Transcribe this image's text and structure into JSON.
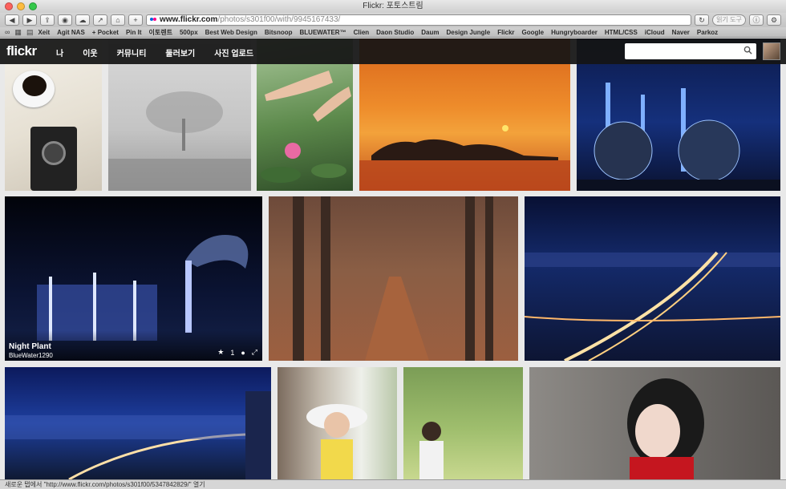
{
  "window": {
    "title": "Flickr: 포토스트림"
  },
  "toolbar": {
    "url_domain": "www.flickr.com",
    "url_path": "/photos/s301f00/with/9945167433/",
    "search_placeholder": "읽기 도구"
  },
  "bookmarks": [
    "Xeit",
    "Agit NAS",
    "+ Pocket",
    "Pin It",
    "이토렌트",
    "500px",
    "Best Web Design",
    "Bitsnoop",
    "BLUEWATER™",
    "Clien",
    "Daon Studio",
    "Daum",
    "Design Jungle",
    "Flickr",
    "Google",
    "Hungryboarder",
    "HTML/CSS",
    "iCloud",
    "Naver",
    "Parkoz"
  ],
  "flickr": {
    "logo": "flickr",
    "nav": [
      "나",
      "이웃",
      "커뮤니티",
      "둘러보기",
      "사진 업로드"
    ]
  },
  "photos": {
    "night_plant": {
      "title": "Night Plant",
      "owner": "BlueWater1290",
      "fav_count": "1"
    }
  },
  "statusbar": {
    "text": "새로운 탭에서 \"http://www.flickr.com/photos/s301f00/5347842829/\" 열기"
  }
}
